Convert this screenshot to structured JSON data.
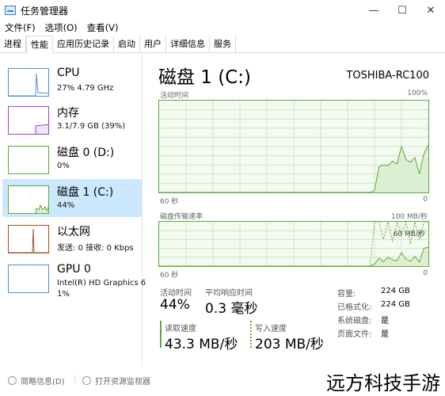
{
  "window": {
    "title": "任务管理器",
    "buttons": {
      "minimize": "—",
      "maximize": "☐",
      "close": "✕"
    }
  },
  "menu": [
    "文件(F)",
    "选项(O)",
    "查看(V)"
  ],
  "tabs": [
    "进程",
    "性能",
    "应用历史记录",
    "启动",
    "用户",
    "详细信息",
    "服务"
  ],
  "sidebar": {
    "items": [
      {
        "title": "CPU",
        "sub1": "27% 4.79 GHz"
      },
      {
        "title": "内存",
        "sub1": "3.1/7.9 GB (39%)"
      },
      {
        "title": "磁盘 0 (D:)",
        "sub1": "0%"
      },
      {
        "title": "磁盘 1 (C:)",
        "sub1": "44%"
      },
      {
        "title": "以太网",
        "sub1": "发送: 0 接收: 0 Kbps"
      },
      {
        "title": "GPU 0",
        "sub1": "Intel(R) HD Graphics 6",
        "sub2": "1%"
      }
    ]
  },
  "main": {
    "title": "磁盘 1 (C:)",
    "model": "TOSHIBA-RC100",
    "chart1": {
      "label": "活动时间",
      "max": "100%",
      "time": "60 秒",
      "min": "0"
    },
    "chart2": {
      "label": "磁盘传输速率",
      "max": "100 MB/秒",
      "mid": "60 MB/秒",
      "time": "60 秒",
      "min": "0"
    },
    "stats": {
      "active_label": "活动时间",
      "active_value": "44%",
      "resp_label": "平均响应时间",
      "resp_value": "0.3 毫秒",
      "read_label": "读取速度",
      "read_value": "43.3 MB/秒",
      "write_label": "写入速度",
      "write_value": "203 MB/秒"
    },
    "props": [
      {
        "label": "容量:",
        "value": "224 GB"
      },
      {
        "label": "已格式化:",
        "value": "224 GB"
      },
      {
        "label": "系统磁盘:",
        "value": "是"
      },
      {
        "label": "页面文件:",
        "value": "是"
      }
    ]
  },
  "footer": {
    "summary": "简略信息(D)",
    "monitor": "打开资源监视器"
  },
  "watermark": "远方科技手游",
  "colors": {
    "cpu": "#4a90d9",
    "memory": "#a040c8",
    "disk": "#5fa83a",
    "ethernet": "#a0522d",
    "gpu": "#4a90d9",
    "selected": "#cce8ff"
  },
  "chart_data": [
    {
      "type": "area",
      "title": "活动时间",
      "x_unit": "秒",
      "xlim": [
        60,
        0
      ],
      "ylim": [
        0,
        100
      ],
      "y_unit": "%",
      "values": [
        0,
        0,
        0,
        0,
        0,
        0,
        0,
        0,
        0,
        0,
        0,
        0,
        0,
        0,
        0,
        0,
        0,
        0,
        0,
        0,
        0,
        0,
        0,
        0,
        0,
        0,
        0,
        0,
        0,
        0,
        0,
        0,
        0,
        0,
        0,
        0,
        0,
        0,
        0,
        0,
        0,
        0,
        0,
        0,
        0,
        0,
        0,
        0,
        2,
        28,
        30,
        29,
        34,
        31,
        50,
        36,
        33,
        38,
        20,
        42,
        52
      ]
    },
    {
      "type": "area",
      "title": "磁盘传输速率",
      "ylim": [
        0,
        100
      ],
      "y_unit": "MB/秒",
      "series": [
        {
          "name": "读取速度",
          "values": [
            0,
            0,
            0,
            0,
            0,
            0,
            0,
            0,
            0,
            0,
            0,
            0,
            0,
            0,
            0,
            0,
            0,
            0,
            0,
            0,
            0,
            0,
            0,
            0,
            0,
            0,
            0,
            0,
            0,
            0,
            0,
            0,
            0,
            0,
            0,
            0,
            0,
            0,
            0,
            0,
            0,
            0,
            0,
            0,
            0,
            0,
            0,
            0,
            4,
            18,
            10,
            20,
            14,
            12,
            30,
            16,
            11,
            22,
            9,
            40,
            43
          ]
        },
        {
          "name": "写入速度",
          "values": [
            0,
            0,
            0,
            0,
            0,
            0,
            0,
            0,
            0,
            0,
            0,
            0,
            0,
            0,
            0,
            0,
            0,
            0,
            0,
            0,
            0,
            0,
            0,
            0,
            0,
            0,
            0,
            0,
            0,
            0,
            0,
            0,
            0,
            0,
            0,
            0,
            0,
            0,
            0,
            0,
            0,
            0,
            0,
            0,
            0,
            0,
            0,
            0,
            100,
            100,
            60,
            100,
            55,
            100,
            70,
            100,
            50,
            100,
            60,
            100,
            100
          ]
        }
      ]
    }
  ]
}
